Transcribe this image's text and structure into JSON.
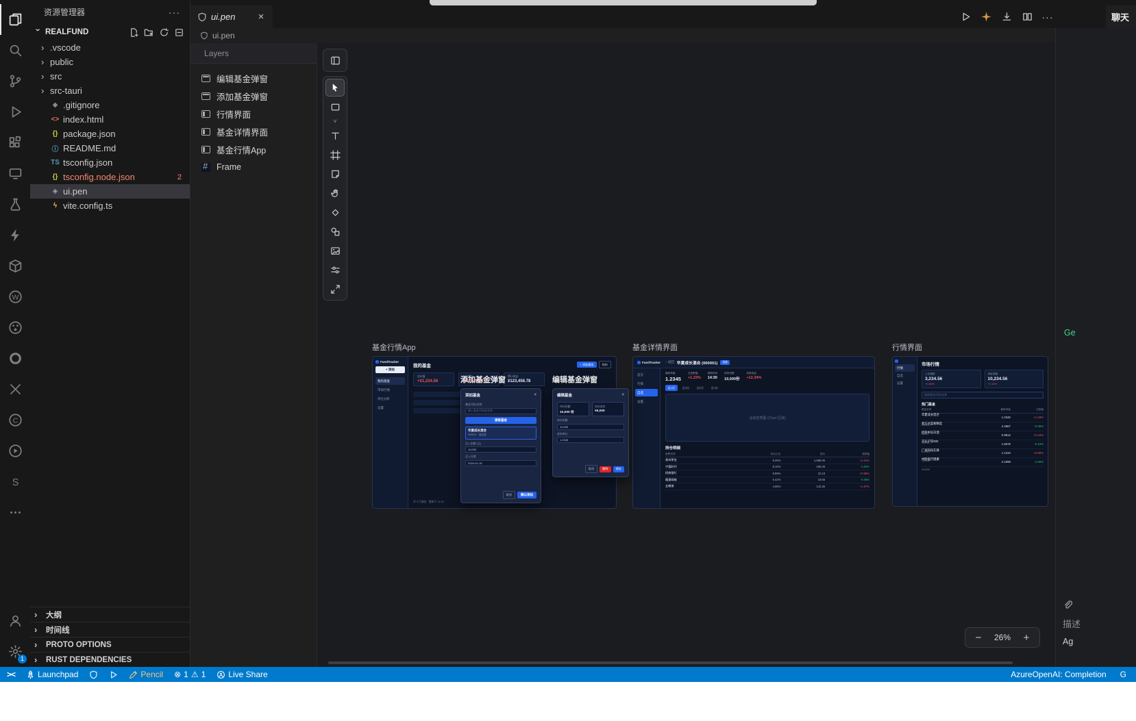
{
  "colors": {
    "accent_blue": "#2563eb",
    "status_blue": "#007acc",
    "error_red": "#f48771",
    "gain_red": "#ef5350",
    "loss_green": "#26c281",
    "pencil_orange": "#d19a43"
  },
  "activity_bar": {
    "icon_names": [
      "explorer",
      "search",
      "source-control",
      "run-debug",
      "extensions",
      "remote-explorer",
      "testing",
      "thunder-client",
      "package-explorer",
      "wakatime",
      "paint",
      "dependency-ring",
      "xml-tools",
      "c-lang",
      "player-ext",
      "svelte-ext",
      "more",
      "accounts",
      "settings"
    ],
    "settings_badge": "1"
  },
  "sidebar": {
    "title": "资源管理器",
    "more": "···",
    "section": {
      "name": "REALFUND"
    },
    "files": [
      {
        "label": ".vscode",
        "twisty": "›",
        "glyph": "",
        "color": ""
      },
      {
        "label": "public",
        "twisty": "›",
        "glyph": "",
        "color": ""
      },
      {
        "label": "src",
        "twisty": "›",
        "glyph": "",
        "color": ""
      },
      {
        "label": "src-tauri",
        "twisty": "›",
        "glyph": "",
        "color": ""
      },
      {
        "label": ".gitignore",
        "twisty": "",
        "glyph": "◆",
        "color": "#8a8a8a"
      },
      {
        "label": "index.html",
        "twisty": "",
        "glyph": "<>",
        "color": "#e8774f"
      },
      {
        "label": "package.json",
        "twisty": "",
        "glyph": "{}",
        "color": "#cbcb41"
      },
      {
        "label": "README.md",
        "twisty": "",
        "glyph": "ⓘ",
        "color": "#519aba"
      },
      {
        "label": "tsconfig.json",
        "twisty": "",
        "glyph": "TS",
        "color": "#519aba"
      },
      {
        "label": "tsconfig.node.json",
        "twisty": "",
        "glyph": "{}",
        "color": "#cbcb41",
        "state": "error",
        "badge": "2"
      },
      {
        "label": "ui.pen",
        "twisty": "",
        "glyph": "◈",
        "color": "#9da5b4",
        "state": "selected"
      },
      {
        "label": "vite.config.ts",
        "twisty": "",
        "glyph": "ϟ",
        "color": "#e8c545"
      }
    ],
    "bottom_sections": [
      {
        "label": "大纲"
      },
      {
        "label": "时间线"
      },
      {
        "label": "PROTO OPTIONS"
      },
      {
        "label": "RUST DEPENDENCIES"
      }
    ]
  },
  "editor": {
    "tab_label": "ui.pen",
    "tab_close": "×",
    "breadcrumb": "ui.pen",
    "action_names": [
      "run",
      "pencil-preview",
      "export",
      "split-editor",
      "more"
    ],
    "more_glyph": "···",
    "layers": {
      "title": "Layers",
      "items": [
        {
          "label": "编辑基金弹窗",
          "icon": "dialog"
        },
        {
          "label": "添加基金弹窗",
          "icon": "dialog"
        },
        {
          "label": "行情界面",
          "icon": "screen"
        },
        {
          "label": "基金详情界面",
          "icon": "screen"
        },
        {
          "label": "基金行情App",
          "icon": "screen"
        },
        {
          "label": "Frame",
          "icon": "frame"
        }
      ]
    },
    "tool_names": [
      "panel-toggle",
      "select",
      "rectangle",
      "shape-dropdown",
      "text",
      "frame",
      "note",
      "hand",
      "connector",
      "shapes",
      "image",
      "properties",
      "resize"
    ],
    "zoom": {
      "minus": "−",
      "value": "26%",
      "plus": "+"
    }
  },
  "canvas": {
    "app": {
      "label": "基金行情App",
      "logo": "FundTracker",
      "sidebar_button": "+ 添加",
      "nav": [
        {
          "label": "我的基金",
          "active": "active"
        },
        {
          "label": "市场行情"
        },
        {
          "label": "持仓分析"
        },
        {
          "label": "设置"
        }
      ],
      "title": "我的基金",
      "btn_primary": "+ 添加基金",
      "btn_ghost": "刷新",
      "stats": [
        {
          "label": "总市值",
          "value": "+¥1,234.56",
          "cls": "red"
        },
        {
          "label": "今日收益",
          "value": "¥123,456.67",
          "cls": "red"
        },
        {
          "label": "累计收益",
          "value": "¥123,456.78",
          "cls": "white"
        }
      ],
      "footer": "共 5 只基金 · 更新于 14:30"
    },
    "add_modal": {
      "label": "添加基金弹窗",
      "title": "添加基金",
      "close": "×",
      "code_label": "基金代码/名称",
      "code_placeholder": "输入基金代码或名称",
      "search_button": "搜索基金",
      "result_name": "华夏成长混合",
      "result_sub": "000001 · 混合型",
      "amount_label": "买入金额 (元)",
      "amount_value": "10,000",
      "date_label": "买入日期",
      "date_value": "2024-01-15",
      "cancel": "取消",
      "confirm": "确认添加"
    },
    "edit_modal": {
      "label": "编辑基金弹窗",
      "title": "编辑基金",
      "close": "×",
      "stats": [
        {
          "label": "持仓份额",
          "value": "10,000 份"
        },
        {
          "label": "持仓成本",
          "value": "¥5,000"
        }
      ],
      "shares_label": "持仓份额",
      "shares_value": "10,000",
      "cost_label": "成本单价",
      "cost_value": "1.2345",
      "cancel": "取消",
      "delete": "删除",
      "save": "保存"
    },
    "detail": {
      "label": "基金详情界面",
      "logo": "FundTracker",
      "back": "‹ 返回",
      "title": "华夏成长混合 (000001)",
      "badge": "自选",
      "nav": [
        {
          "label": "首页"
        },
        {
          "label": "行情"
        },
        {
          "label": "自选",
          "active": "active"
        },
        {
          "label": "设置"
        }
      ],
      "stats": [
        {
          "label": "最新净值",
          "value": "1.2345",
          "cls": "white big"
        },
        {
          "label": "日涨跌幅",
          "value": "+1.23%",
          "cls": "red"
        },
        {
          "label": "更新时间",
          "value": "14:30",
          "cls": "white"
        },
        {
          "label": "持有份额",
          "value": "10,000份",
          "cls": "white"
        },
        {
          "label": "持有收益",
          "value": "+12.34%",
          "cls": "red"
        }
      ],
      "periods": [
        {
          "label": "近1月",
          "active": "active"
        },
        {
          "label": "近3月"
        },
        {
          "label": "近6月"
        },
        {
          "label": "近1年"
        }
      ],
      "chart_placeholder": "业绩走势图 (Chart 区域)",
      "holdings_title": "持仓明细",
      "holdings_headers": [
        "股票名称",
        "持仓占比",
        "现价",
        "涨跌幅"
      ],
      "holdings": [
        {
          "name": "贵州茅台",
          "weight": "9.25%",
          "price": "1,688.00",
          "chg": "+2.15%",
          "cls": "red"
        },
        {
          "name": "宁德时代",
          "weight": "8.10%",
          "price": "188.45",
          "chg": "-1.02%",
          "cls": "green"
        },
        {
          "name": "招商银行",
          "weight": "6.88%",
          "price": "32.18",
          "chg": "+0.88%",
          "cls": "red"
        },
        {
          "name": "隆基绿能",
          "weight": "5.42%",
          "price": "18.66",
          "chg": "-0.45%",
          "cls": "green"
        },
        {
          "name": "五粮液",
          "weight": "4.95%",
          "price": "142.30",
          "chg": "+1.67%",
          "cls": "red"
        }
      ]
    },
    "market": {
      "label": "行情界面",
      "logo": "FundTracker",
      "nav": [
        {
          "label": "行情",
          "active": "active"
        },
        {
          "label": "自选"
        },
        {
          "label": "设置"
        }
      ],
      "title": "市场行情",
      "indices": [
        {
          "label": "上证指数",
          "value": "3,234.56",
          "chg": "+0.56%",
          "cls": "red"
        },
        {
          "label": "深证成指",
          "value": "10,234.56",
          "chg": "+1.12%",
          "cls": "red"
        }
      ],
      "search_placeholder": "搜索基金代码/名称",
      "list_title": "热门基金",
      "list_headers": [
        "基金名称",
        "最新净值",
        "日涨幅"
      ],
      "funds": [
        {
          "name": "华夏成长混合",
          "code": "000001",
          "nav": "1.2345",
          "chg": "+1.23%",
          "cls": "red"
        },
        {
          "name": "易方达蓝筹精选",
          "code": "005827",
          "nav": "2.4567",
          "chg": "-0.45%",
          "cls": "green"
        },
        {
          "name": "招商中证白酒",
          "code": "161725",
          "nav": "0.8912",
          "chg": "+2.34%",
          "cls": "red"
        },
        {
          "name": "天弘沪深300",
          "code": "000961",
          "nav": "1.5678",
          "chg": "-0.12%",
          "cls": "green"
        },
        {
          "name": "广发科技先锋",
          "code": "008903",
          "nav": "1.1234",
          "chg": "+0.89%",
          "cls": "red"
        },
        {
          "name": "中欧医疗健康",
          "code": "003095",
          "nav": "2.1098",
          "chg": "-1.05%",
          "cls": "green"
        }
      ]
    }
  },
  "chat": {
    "tab": "聊天",
    "generate": "Ge",
    "describe": "描述",
    "agent": "Ag"
  },
  "status_bar": {
    "remote": "><",
    "launchpad": "Launchpad",
    "pencil": "Pencil",
    "errors": "1",
    "warnings": "1",
    "error_glyph": "⊗",
    "warning_glyph": "⚠",
    "live_share": "Live Share",
    "azure": "AzureOpenAI: Completion",
    "partial": "G"
  }
}
